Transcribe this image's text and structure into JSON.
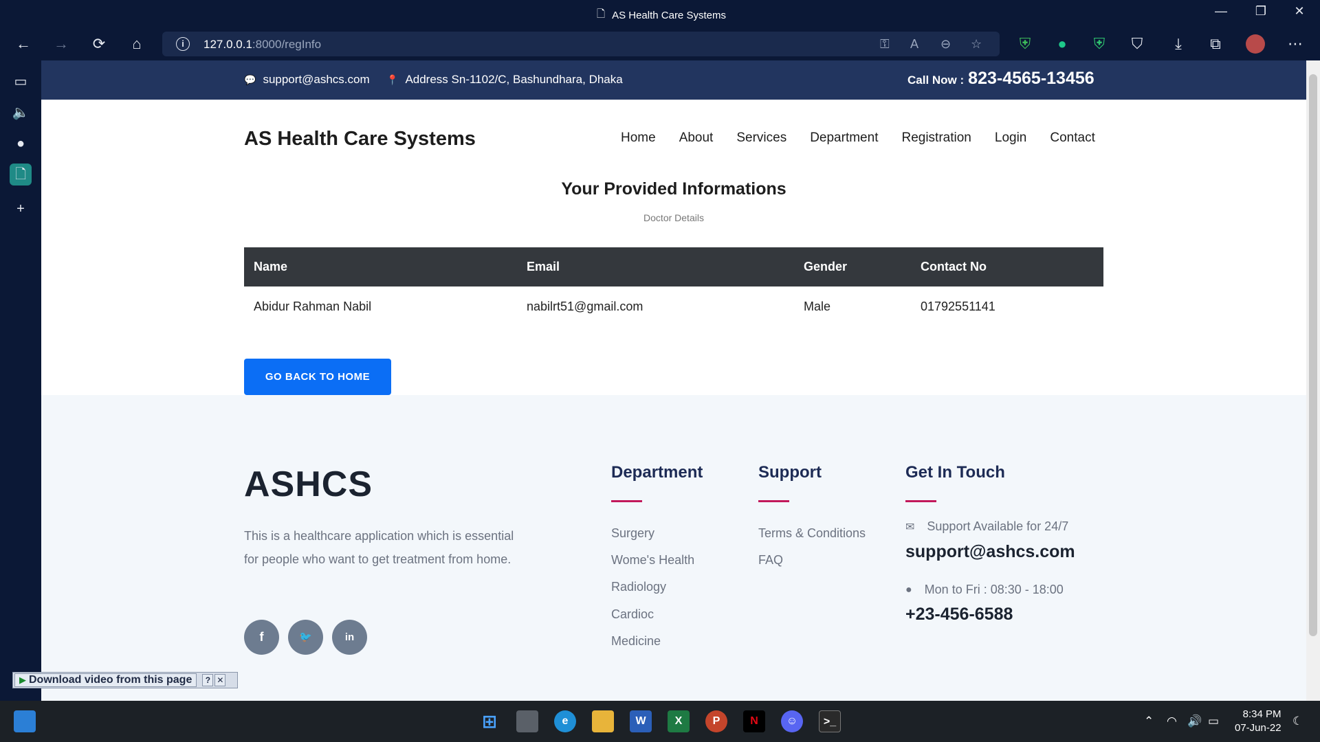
{
  "browser": {
    "window_title": "AS Health Care Systems",
    "url_host": "127.0.0.1",
    "url_rest": ":8000/regInfo",
    "controls": {
      "minimize": "—",
      "restore": "❐",
      "close": "✕"
    }
  },
  "topbar": {
    "email": "support@ashcs.com",
    "address": "Address Sn-1102/C, Bashundhara, Dhaka",
    "call_label": "Call Now :",
    "call_number": "823-4565-13456"
  },
  "header": {
    "brand": "AS Health Care Systems",
    "nav": [
      "Home",
      "About",
      "Services",
      "Department",
      "Registration",
      "Login",
      "Contact"
    ]
  },
  "main": {
    "title": "Your Provided Informations",
    "subtitle": "Doctor Details",
    "table": {
      "columns": [
        "Name",
        "Email",
        "Gender",
        "Contact No"
      ],
      "rows": [
        [
          "Abidur Rahman Nabil",
          "nabilrt51@gmail.com",
          "Male",
          "01792551141"
        ]
      ]
    },
    "back_button": "GO BACK TO HOME"
  },
  "footer": {
    "logo": "ASHCS",
    "description": "This is a healthcare application which is essential for people who want to get treatment from home.",
    "social": [
      {
        "icon": "facebook-icon",
        "glyph": "f"
      },
      {
        "icon": "twitter-icon",
        "glyph": "🐦"
      },
      {
        "icon": "linkedin-icon",
        "glyph": "in"
      }
    ],
    "department": {
      "heading": "Department",
      "links": [
        "Surgery",
        "Wome's Health",
        "Radiology",
        "Cardioc",
        "Medicine"
      ]
    },
    "support": {
      "heading": "Support",
      "links": [
        "Terms & Conditions",
        "FAQ"
      ]
    },
    "contact": {
      "heading": "Get In Touch",
      "availability": "Support Available for 24/7",
      "email": "support@ashcs.com",
      "hours": "Mon to Fri : 08:30 - 18:00",
      "phone": "+23-456-6588"
    }
  },
  "download_bar": {
    "label": "Download video from this page",
    "help": "?",
    "close": "✕"
  },
  "taskbar": {
    "time": "8:34 PM",
    "date": "07-Jun-22"
  },
  "colors": {
    "topbar_bg": "#22355f",
    "button_blue": "#0b6ef5",
    "accent_bar": "#c2185b",
    "table_head_bg": "#34383d"
  }
}
